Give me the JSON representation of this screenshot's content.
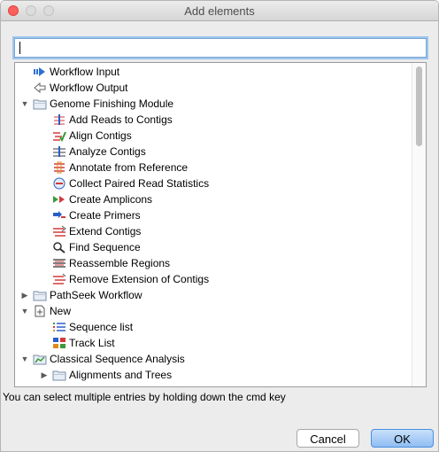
{
  "window": {
    "title": "Add elements"
  },
  "search": {
    "value": "",
    "placeholder": ""
  },
  "tree": [
    {
      "label": "Workflow Input",
      "icon": "arrow-right-icon",
      "toggle": "",
      "depth": 0
    },
    {
      "label": "Workflow Output",
      "icon": "arrow-left-outline-icon",
      "toggle": "",
      "depth": 0
    },
    {
      "label": "Genome Finishing Module",
      "icon": "folder-icon",
      "toggle": "▼",
      "depth": 0
    },
    {
      "label": "Add Reads to Contigs",
      "icon": "add-reads-icon",
      "toggle": "",
      "depth": 1
    },
    {
      "label": "Align Contigs",
      "icon": "align-contigs-icon",
      "toggle": "",
      "depth": 1
    },
    {
      "label": "Analyze Contigs",
      "icon": "analyze-contigs-icon",
      "toggle": "",
      "depth": 1
    },
    {
      "label": "Annotate from Reference",
      "icon": "annotate-reference-icon",
      "toggle": "",
      "depth": 1
    },
    {
      "label": "Collect Paired Read Statistics",
      "icon": "paired-read-stats-icon",
      "toggle": "",
      "depth": 1
    },
    {
      "label": "Create Amplicons",
      "icon": "amplicons-icon",
      "toggle": "",
      "depth": 1
    },
    {
      "label": "Create Primers",
      "icon": "primers-icon",
      "toggle": "",
      "depth": 1
    },
    {
      "label": "Extend Contigs",
      "icon": "extend-contigs-icon",
      "toggle": "",
      "depth": 1
    },
    {
      "label": "Find Sequence",
      "icon": "find-sequence-icon",
      "toggle": "",
      "depth": 1
    },
    {
      "label": "Reassemble Regions",
      "icon": "reassemble-icon",
      "toggle": "",
      "depth": 1
    },
    {
      "label": "Remove Extension of Contigs",
      "icon": "remove-extension-icon",
      "toggle": "",
      "depth": 1
    },
    {
      "label": "PathSeek Workflow",
      "icon": "folder-icon",
      "toggle": "▶",
      "depth": 0
    },
    {
      "label": "New",
      "icon": "new-document-icon",
      "toggle": "▼",
      "depth": 0
    },
    {
      "label": "Sequence list",
      "icon": "sequence-list-icon",
      "toggle": "",
      "depth": 1
    },
    {
      "label": "Track List",
      "icon": "track-list-icon",
      "toggle": "",
      "depth": 1
    },
    {
      "label": "Classical Sequence Analysis",
      "icon": "folder-chart-icon",
      "toggle": "▼",
      "depth": 0
    },
    {
      "label": "Alignments and Trees",
      "icon": "folder-icon",
      "toggle": "▶",
      "depth": 1
    }
  ],
  "hint": "You can select multiple entries by holding down the cmd key",
  "buttons": {
    "cancel": "Cancel",
    "ok": "OK"
  },
  "colors": {
    "accent": "#4a8fe0",
    "close": "#fc605c"
  }
}
